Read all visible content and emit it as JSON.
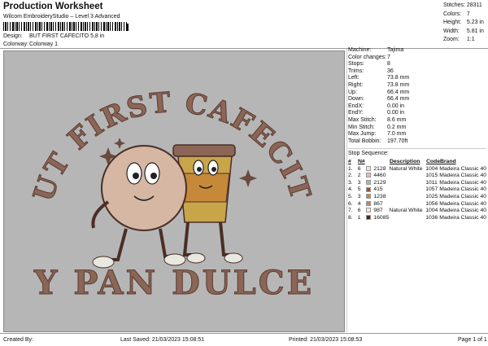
{
  "header": {
    "title": "Production Worksheet",
    "subtitle": "Wilcom EmbroideryStudio – Level 3 Advanced",
    "design_label": "Design:",
    "design_value": "BUT FIRST CAFECITO 5,8 in",
    "colorway_label": "Colorway:",
    "colorway_value": "Colorway 1"
  },
  "stats": [
    {
      "label": "Stitches:",
      "value": "28311"
    },
    {
      "label": "Colors:",
      "value": "7"
    },
    {
      "label": "Height:",
      "value": "5.23 in"
    },
    {
      "label": "Width:",
      "value": "5.81 in"
    },
    {
      "label": "Zoom:",
      "value": "1:1"
    }
  ],
  "machine": [
    {
      "label": "Machine:",
      "value": "Tajima"
    },
    {
      "label": "Color changes:",
      "value": "7"
    },
    {
      "label": "Stops:",
      "value": "8"
    },
    {
      "label": "Trims:",
      "value": "36"
    },
    {
      "label": "Left:",
      "value": "73.8 mm"
    },
    {
      "label": "Right:",
      "value": "73.8 mm"
    },
    {
      "label": "Up:",
      "value": "66.4 mm"
    },
    {
      "label": "Down:",
      "value": "66.4 mm"
    },
    {
      "label": "EndX:",
      "value": "0.00 in"
    },
    {
      "label": "EndY:",
      "value": "0.00 in"
    },
    {
      "label": "Max Stitch:",
      "value": "8.6 mm"
    },
    {
      "label": "Min Stitch:",
      "value": "0.2 mm"
    },
    {
      "label": "Max Jump:",
      "value": "7.0 mm"
    },
    {
      "label": "Total Bobbin:",
      "value": "197.70ft"
    }
  ],
  "sequence": {
    "title": "Stop Sequence:",
    "headers": {
      "num": "#",
      "n": "N#",
      "desc": "Description",
      "code": "Code",
      "brand": "Brand"
    },
    "rows": [
      {
        "num": "1.",
        "n": "6",
        "color": "#ece8e2",
        "code_n": "2128",
        "desc": "Natural White",
        "code": "1004",
        "brand": "Madeira Classic 40"
      },
      {
        "num": "2.",
        "n": "2",
        "color": "#e8b9b0",
        "code_n": "4460",
        "desc": "",
        "code": "1015",
        "brand": "Madeira Classic 40"
      },
      {
        "num": "3.",
        "n": "3",
        "color": "#a9b8a6",
        "code_n": "2129",
        "desc": "",
        "code": "1011",
        "brand": "Madeira Classic 40"
      },
      {
        "num": "4.",
        "n": "5",
        "color": "#a0522d",
        "code_n": "415",
        "desc": "",
        "code": "1057",
        "brand": "Madeira Classic 40"
      },
      {
        "num": "5.",
        "n": "3",
        "color": "#c98a2e",
        "code_n": "1238",
        "desc": "",
        "code": "1025",
        "brand": "Madeira Classic 40"
      },
      {
        "num": "6.",
        "n": "4",
        "color": "#b98472",
        "code_n": "867",
        "desc": "",
        "code": "1056",
        "brand": "Madeira Classic 40"
      },
      {
        "num": "7.",
        "n": "6",
        "color": "#ece8e2",
        "code_n": "987",
        "desc": "Natural White",
        "code": "1004",
        "brand": "Madeira Classic 40"
      },
      {
        "num": "8.",
        "n": "1",
        "color": "#4a2622",
        "code_n": "16085",
        "desc": "",
        "code": "1036",
        "brand": "Madeira Classic 40"
      }
    ]
  },
  "design_art": {
    "top_text": "BUT FIRST CAFECITO",
    "bottom_text": "Y PAN DULCE"
  },
  "footer": {
    "created": "Created By:",
    "saved": "Last Saved: 21/03/2023 15:08:51",
    "printed": "Printed: 21/03/2023 15:08:53",
    "page": "Page 1 of 1"
  }
}
